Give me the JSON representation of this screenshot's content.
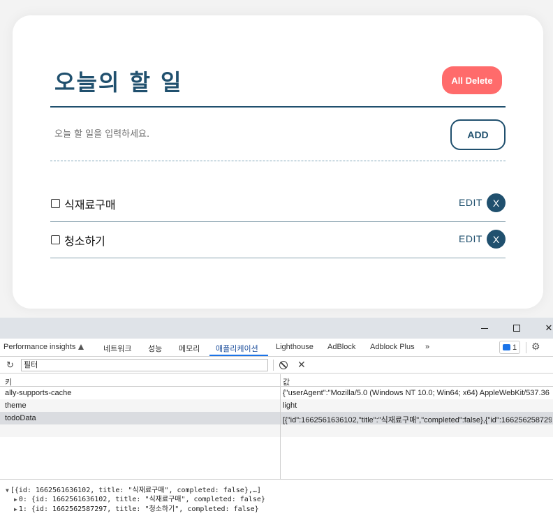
{
  "app": {
    "title": "오늘의 할 일",
    "all_delete_label": "All Delete",
    "input_placeholder": "오늘 할 일을 입력하세요.",
    "add_label": "ADD",
    "todos": [
      {
        "title": "식재료구매",
        "edit_label": "EDIT",
        "delete_label": "X",
        "completed": false
      },
      {
        "title": "청소하기",
        "edit_label": "EDIT",
        "delete_label": "X",
        "completed": false
      }
    ]
  },
  "devtools": {
    "window_close": "✕",
    "tabs": [
      "Performance insights",
      "네트워크",
      "성능",
      "메모리",
      "애플리케이션",
      "Lighthouse",
      "AdBlock",
      "Adblock Plus",
      "»"
    ],
    "active_tab": "애플리케이션",
    "issues_count": "1",
    "filter_placeholder": "필터",
    "columns": {
      "key": "키",
      "value": "값"
    },
    "rows": [
      {
        "key": "ally-supports-cache",
        "value": "{\"userAgent\":\"Mozilla/5.0 (Windows NT 10.0; Win64; x64) AppleWebKit/537.36 (..."
      },
      {
        "key": "theme",
        "value": "light"
      },
      {
        "key": "todoData",
        "value": "[{\"id\":1662561636102,\"title\":\"식재료구매\",\"completed\":false},{\"id\":166256258729..."
      }
    ],
    "preview": {
      "root": "[{id: 1662561636102, title: \"식재료구매\", completed: false},…]",
      "item0": "0: {id: 1662561636102, title: \"식재료구매\", completed: false}",
      "item1": "1: {id: 1662562587297, title: \"청소하기\", completed: false}"
    }
  }
}
